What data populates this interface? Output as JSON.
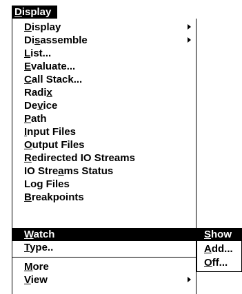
{
  "menubar": {
    "display": {
      "pre": "",
      "u": "D",
      "post": "isplay"
    }
  },
  "menu": {
    "items": [
      {
        "pre": "",
        "u": "D",
        "post": "isplay"
      },
      {
        "pre": "Di",
        "u": "s",
        "post": "assemble"
      },
      {
        "pre": "",
        "u": "L",
        "post": "ist..."
      },
      {
        "pre": "",
        "u": "E",
        "post": "valuate..."
      },
      {
        "pre": "",
        "u": "C",
        "post": "all Stack..."
      },
      {
        "pre": "Radi",
        "u": "x",
        "post": ""
      },
      {
        "pre": "De",
        "u": "v",
        "post": "ice"
      },
      {
        "pre": "",
        "u": "P",
        "post": "ath"
      },
      {
        "pre": "",
        "u": "I",
        "post": "nput Files"
      },
      {
        "pre": "",
        "u": "O",
        "post": "utput Files"
      },
      {
        "pre": "",
        "u": "R",
        "post": "edirected IO Streams"
      },
      {
        "pre": "IO Stre",
        "u": "a",
        "post": "ms Status"
      },
      {
        "pre": "Lo",
        "u": "g",
        "post": " Files"
      },
      {
        "pre": "",
        "u": "B",
        "post": "reakpoints"
      },
      {
        "pre": "",
        "u": "W",
        "post": "atch"
      },
      {
        "pre": "",
        "u": "T",
        "post": "ype.."
      },
      {
        "pre": "",
        "u": "M",
        "post": "ore"
      },
      {
        "pre": "",
        "u": "V",
        "post": "iew"
      }
    ]
  },
  "watch_submenu": {
    "items": [
      {
        "pre": "",
        "u": "S",
        "post": "how"
      },
      {
        "pre": "",
        "u": "A",
        "post": "dd..."
      },
      {
        "pre": "",
        "u": "O",
        "post": "ff..."
      }
    ]
  },
  "colors": {
    "highlight": "#000000",
    "highlight_text": "#ffffff",
    "background": "#ffffff"
  }
}
